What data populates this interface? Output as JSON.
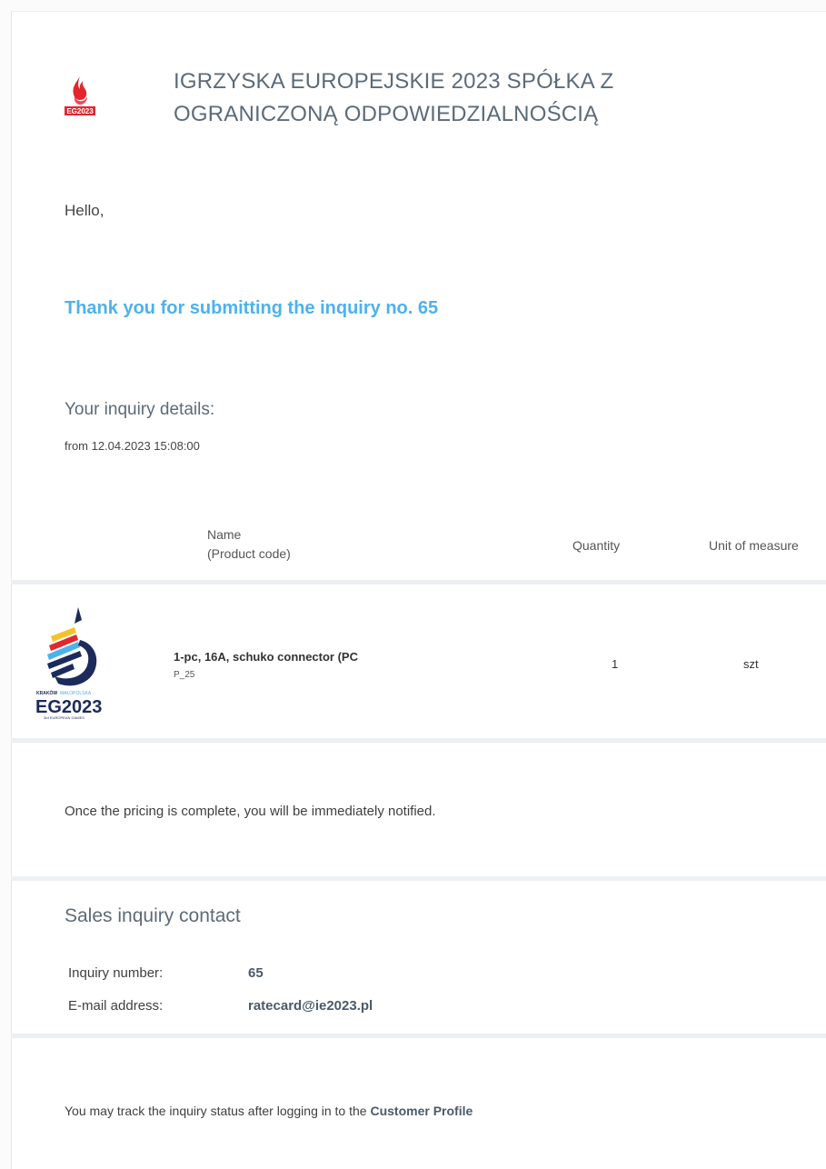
{
  "header": {
    "org_name_line1": "IGRZYSKA EUROPEJSKIE 2023 SPÓŁKA Z",
    "org_name_line2": "OGRANICZONĄ ODPOWIEDZIALNOŚCIĄ",
    "logo_text": "EG2023"
  },
  "message": {
    "greeting": "Hello,",
    "thanks": "Thank you for submitting the inquiry no. 65",
    "details_title": "Your inquiry details:",
    "details_date": "from 12.04.2023 15:08:00",
    "notice": "Once the pricing is complete, you will be immediately notified."
  },
  "table": {
    "headers": {
      "name": "Name",
      "code": "(Product code)",
      "quantity": "Quantity",
      "unit": "Unit of measure"
    },
    "rows": [
      {
        "name": "1-pc, 16A, schuko connector (PC",
        "code": "P_25",
        "quantity": "1",
        "unit": "szt",
        "logo_text": {
          "city": "KRAKÓW",
          "region": "MAŁOPOLSKA",
          "brand": "EG2023",
          "sub": "3rd EUROPEAN GAMES"
        }
      }
    ]
  },
  "contact": {
    "title": "Sales inquiry contact",
    "inquiry_label": "Inquiry number:",
    "inquiry_value": "65",
    "email_label": "E-mail address:",
    "email_value": "ratecard@ie2023.pl"
  },
  "footer": {
    "track_text": "You may track the inquiry status after logging in to the",
    "track_link": "Customer Profile"
  },
  "colors": {
    "accent": "#4db2ec",
    "heading": "#5c6b79",
    "divider": "#edf0f3",
    "logo_red": "#e3262e",
    "logo_navy": "#1c2a5c"
  }
}
